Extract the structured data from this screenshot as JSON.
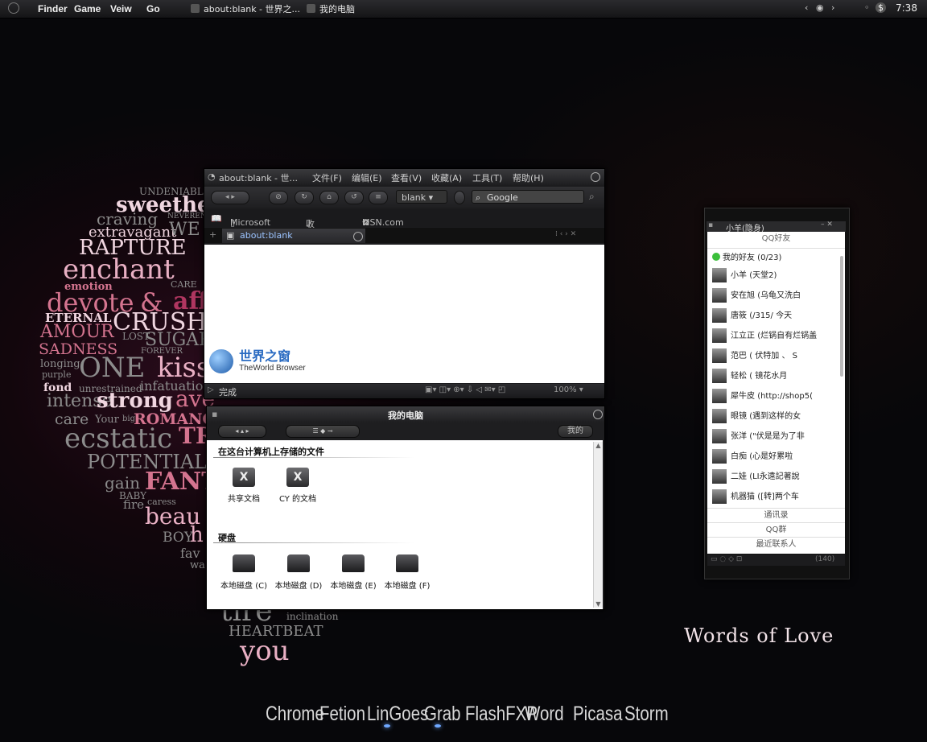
{
  "menubar": {
    "items": [
      "Finder",
      "Game",
      "Veiw",
      "Go"
    ],
    "tasks": [
      "about:blank - 世界之...",
      "我的电脑"
    ],
    "clock": "7:38"
  },
  "wallpaper": {
    "words": [
      "UNDENIABLE",
      "sweethe",
      "craving",
      "NEVERENDING",
      "extravagant",
      "WE",
      "RAPTURE",
      "enchant",
      "emotion",
      "CARE",
      "devote",
      "&",
      "aff",
      "ETERNAL",
      "CRUSH",
      "AMOUR",
      "LOST",
      "SUGAR",
      "SADNESS",
      "FOREVER",
      "longing",
      "purple",
      "ONE",
      "kiss",
      "fond",
      "unrestrained",
      "infatuation",
      "intense",
      "strong",
      "ave",
      "care",
      "Your",
      "big",
      "ROMANC",
      "ecstatic",
      "TR",
      "POTENTIAL",
      "gain",
      "FANT",
      "BABY",
      "fire",
      "caress",
      "beau",
      "BOY",
      "h",
      "fav",
      "wa",
      "tire",
      "inclination",
      "HEARTBEAT",
      "you"
    ],
    "brand": "Words of Love"
  },
  "browser": {
    "title": "about:blank - 世...",
    "menu": [
      "文件(F)",
      "编辑(E)",
      "查看(V)",
      "收藏(A)",
      "工具(T)",
      "帮助(H)"
    ],
    "address": "blank",
    "search_placeholder": "Google",
    "favorites": [
      "Microsoft 网站",
      "收藏夹栏",
      "MSN.com"
    ],
    "tab": "about:blank",
    "logo_cn": "世界之窗",
    "logo_en": "TheWorld Browser",
    "status": "完成",
    "zoom": "100%"
  },
  "explorer": {
    "title": "我的电脑",
    "pill_label": "我的",
    "section_files": "在这台计算机上存储的文件",
    "folders": [
      "共享文档",
      "CY 的文档"
    ],
    "folder_glyph": "X",
    "section_drives": "硬盘",
    "drives": [
      "本地磁盘 (C)",
      "本地磁盘 (D)",
      "本地磁盘 (E)",
      "本地磁盘 (F)"
    ]
  },
  "qq": {
    "title": "小羊(隐身)",
    "tab_friends": "QQ好友",
    "group": "我的好友 (0/23)",
    "contacts": [
      {
        "name": "小羊",
        "status": "(天堂2)"
      },
      {
        "name": "安在旭",
        "status": "(乌龟又洗白"
      },
      {
        "name": "唐筱",
        "status": "(/315/ 今天"
      },
      {
        "name": "江立正",
        "status": "(烂锅自有烂锅盖"
      },
      {
        "name": "范巴",
        "status": "( 伏特加 、 S"
      },
      {
        "name": "轻松",
        "status": "( 镜花水月"
      },
      {
        "name": "犀牛皮",
        "status": "(http://shop5("
      },
      {
        "name": "眼镜",
        "status": "(遇到这样的女"
      },
      {
        "name": "张洋",
        "status": "(\"伏是是为了非"
      },
      {
        "name": "白痴",
        "status": "(心是好累啦"
      },
      {
        "name": "二娃",
        "status": "(LI永遠記著說"
      },
      {
        "name": "机器猫",
        "status": "([转]两个车"
      }
    ],
    "footer": [
      "通讯录",
      "QQ群",
      "最近联系人"
    ],
    "count": "(140)"
  },
  "dock": [
    "Chrome",
    "Fetion",
    "LinGoes",
    "Grab",
    "FlashFXP",
    "Word",
    "Picasa",
    "Storm"
  ]
}
